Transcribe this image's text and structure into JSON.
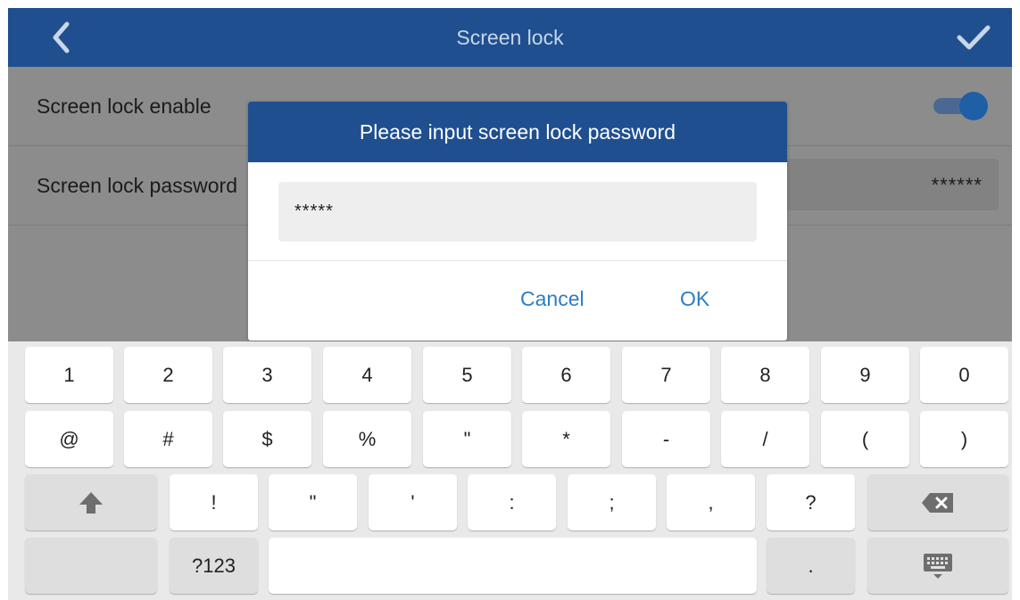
{
  "header": {
    "title": "Screen lock",
    "back_icon": "chevron-left-icon",
    "confirm_icon": "checkmark-icon"
  },
  "settings": {
    "screen_lock_enable_label": "Screen lock enable",
    "screen_lock_enable_on": true,
    "screen_lock_password_label": "Screen lock password",
    "screen_lock_password_value": "******"
  },
  "dialog": {
    "title": "Please input screen lock password",
    "input_value": "*****",
    "cancel_label": "Cancel",
    "ok_label": "OK"
  },
  "keyboard": {
    "row1": [
      "1",
      "2",
      "3",
      "4",
      "5",
      "6",
      "7",
      "8",
      "9",
      "0"
    ],
    "row2": [
      "@",
      "#",
      "$",
      "%",
      "\"",
      "*",
      "-",
      "/",
      "(",
      ")"
    ],
    "row3": [
      "!",
      "\"",
      "'",
      ":",
      ";",
      ",",
      "?"
    ],
    "shift_icon": "shift-arrow-icon",
    "backspace_icon": "backspace-icon",
    "symbols_label": "?123",
    "period_label": ".",
    "keyboard_hide_icon": "keyboard-icon"
  },
  "colors": {
    "header_bg": "#1f4f8f",
    "dialog_header_bg": "#1f4f8f",
    "dialog_button": "#2d7cc4",
    "toggle_on": "#1f5fa6",
    "dim_overlay_bg": "#8c8c8c",
    "keyboard_bg": "#e9e9e9"
  }
}
